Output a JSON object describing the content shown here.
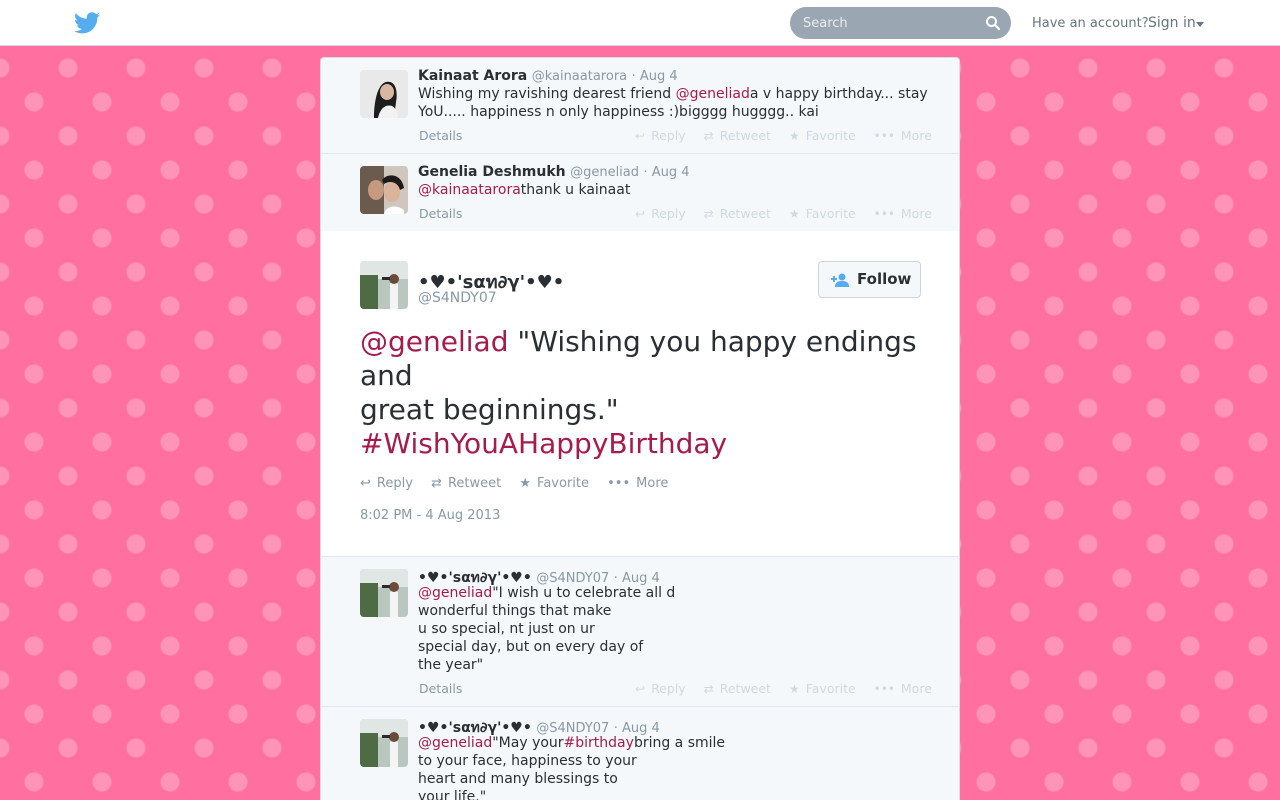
{
  "header": {
    "search_placeholder": "Search",
    "have_account": "Have an account?",
    "sign_in": "Sign in"
  },
  "tweets_above": [
    {
      "fullname": "Kainaat Arora",
      "handle": "@kainaatarora",
      "date": "· Aug 4",
      "mention": "@geneliad",
      "text_before": "Wishing my ravishing dearest friend ",
      "text_after": "a v happy birthday... stay YoU..... happiness n only happiness :)bigggg hugggg.. kai",
      "details": "Details"
    },
    {
      "fullname": "Genelia Deshmukh",
      "handle": "@geneliad",
      "date": "· Aug 4",
      "mention": "@kainaatarora",
      "text_after": "thank u kainaat",
      "details": "Details"
    }
  ],
  "actions": {
    "reply": "Reply",
    "retweet": "Retweet",
    "favorite": "Favorite",
    "more": "More"
  },
  "focus": {
    "fullname": "•♥•'sαท∂γ'•♥•",
    "handle": "@S4NDY07",
    "follow": "Follow",
    "mention": "@geneliad",
    "text": " \"Wishing you happy endings and\ngreat beginnings.\"",
    "hashtag": "#WishYouAHappyBirthday",
    "timestamp": "8:02 PM - 4 Aug 2013"
  },
  "replies": [
    {
      "fullname": "•♥•'sαท∂γ'•♥•",
      "handle": "@S4NDY07",
      "date": "· Aug 4",
      "mention": "@geneliad",
      "text_after": "\"I wish u to celebrate all d\nwonderful things that make\nu so special, nt just on ur\nspecial day, but on every day of\nthe year\"",
      "details": "Details"
    },
    {
      "fullname": "•♥•'sαท∂γ'•♥•",
      "handle": "@S4NDY07",
      "date": "· Aug 4",
      "mention": "@geneliad",
      "text_mid": "\"May your",
      "hashtag": "#birthday",
      "text_after": "bring a smile\nto your face, happiness to your\nheart and many blessings to\nyour life.\""
    }
  ],
  "colors": {
    "background": "#ff6fa0",
    "link": "#a41d49",
    "twitter_blue": "#55acee"
  }
}
